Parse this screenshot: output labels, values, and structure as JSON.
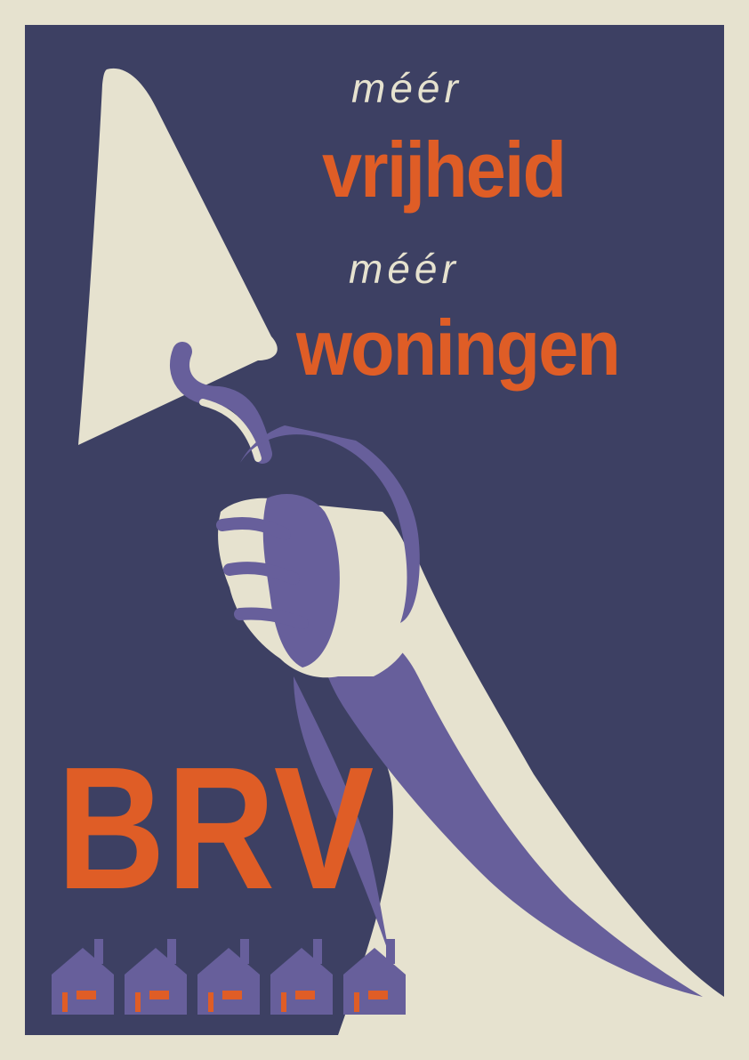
{
  "headline": {
    "line1_small": "méér",
    "line1_big": "vrijheid",
    "line2_small": "méér",
    "line2_big": "woningen"
  },
  "party": "BRV",
  "house_count": 5,
  "colors": {
    "background_navy": "#3d4063",
    "cream": "#e6e2cf",
    "orange": "#df5d26",
    "purple": "#675f9b"
  },
  "icons": [
    "trowel-icon",
    "hand-icon",
    "house-icon"
  ]
}
